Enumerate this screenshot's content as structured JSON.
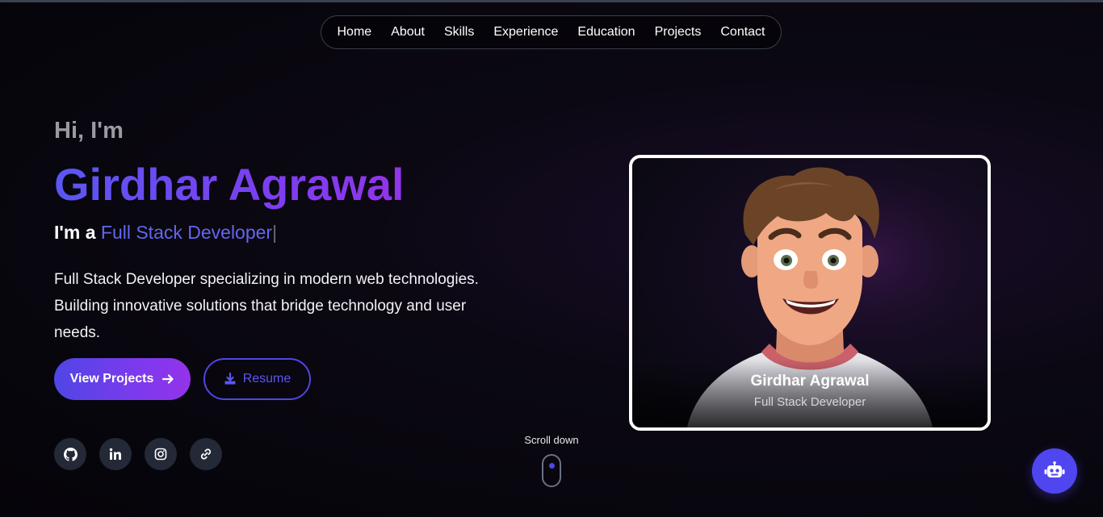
{
  "nav": {
    "items": [
      {
        "label": "Home"
      },
      {
        "label": "About"
      },
      {
        "label": "Skills"
      },
      {
        "label": "Experience"
      },
      {
        "label": "Education"
      },
      {
        "label": "Projects"
      },
      {
        "label": "Contact"
      }
    ]
  },
  "hero": {
    "greeting": "Hi, I'm",
    "name": "Girdhar Agrawal",
    "role_prefix": "I'm a",
    "role_typed": "Full Stack Developer",
    "role_cursor": "|",
    "description": "Full Stack Developer specializing in modern web technologies. Building innovative solutions that bridge technology and user needs.",
    "primary_button": "View Projects",
    "secondary_button": "Resume"
  },
  "socials": [
    {
      "icon": "github-icon"
    },
    {
      "icon": "linkedin-icon"
    },
    {
      "icon": "instagram-icon"
    },
    {
      "icon": "link-icon"
    }
  ],
  "scroll": {
    "label": "Scroll down"
  },
  "profile_card": {
    "name": "Girdhar Agrawal",
    "role": "Full Stack Developer"
  },
  "colors": {
    "accent": "#4f46e5",
    "accent_purple": "#9333ea",
    "background": "#050409"
  }
}
